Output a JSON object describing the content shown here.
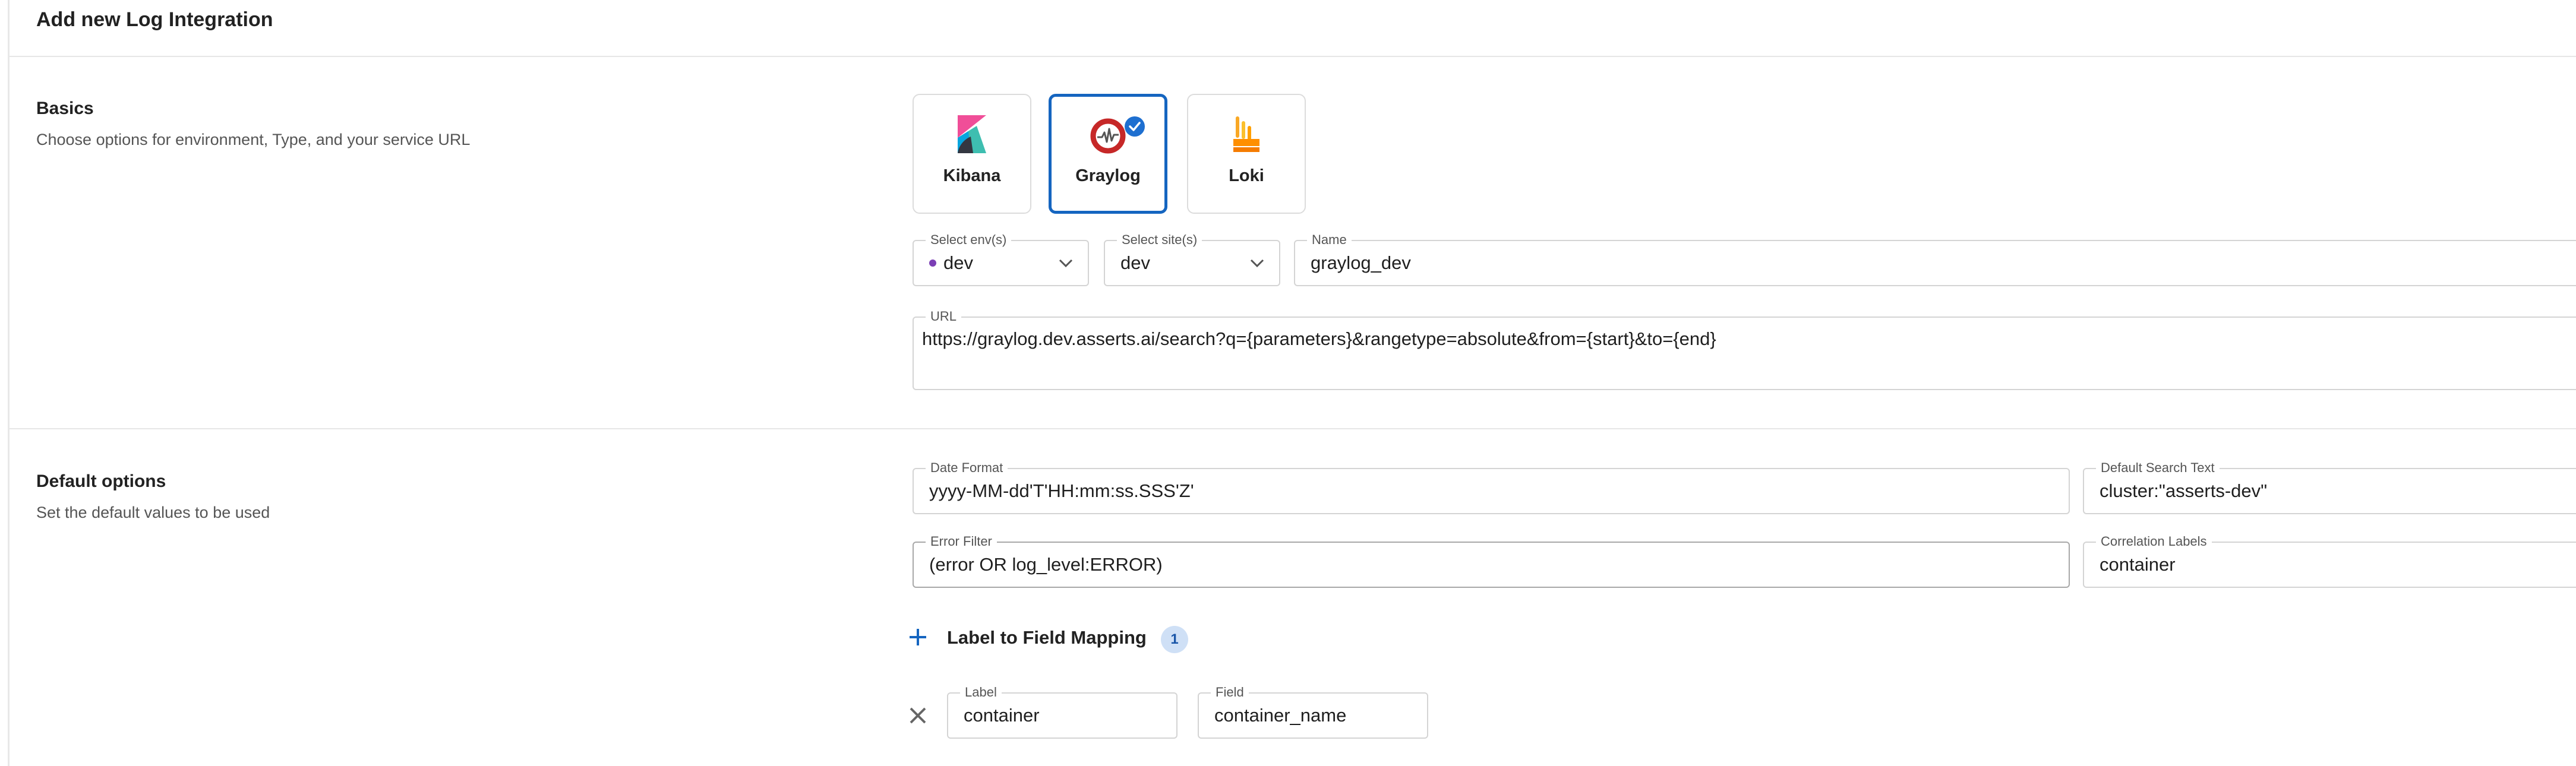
{
  "page": {
    "title": "Add new Log Integration"
  },
  "basics": {
    "title": "Basics",
    "subtitle": "Choose options for environment, Type, and your service URL",
    "types": [
      {
        "label": "Kibana",
        "icon": "kibana-logo-icon",
        "selected": false
      },
      {
        "label": "Graylog",
        "icon": "graylog-logo-icon",
        "selected": true
      },
      {
        "label": "Loki",
        "icon": "loki-logo-icon",
        "selected": false
      }
    ],
    "env": {
      "label": "Select env(s)",
      "value": "dev",
      "dot_color": "#7b3fb5"
    },
    "site": {
      "label": "Select site(s)",
      "value": "dev"
    },
    "name": {
      "label": "Name",
      "value": "graylog_dev"
    },
    "url": {
      "label": "URL",
      "value": "https://graylog.dev.asserts.ai/search?q={parameters}&rangetype=absolute&from={start}&to={end}"
    }
  },
  "defaults": {
    "title": "Default options",
    "subtitle": "Set the default values to be used",
    "date_format": {
      "label": "Date Format",
      "value": "yyyy-MM-dd'T'HH:mm:ss.SSS'Z'"
    },
    "search_text": {
      "label": "Default Search Text",
      "value": "cluster:\"asserts-dev\""
    },
    "error_filter": {
      "label": "Error Filter",
      "value": "(error OR log_level:ERROR)"
    },
    "correlation": {
      "label": "Correlation Labels",
      "value": "container"
    },
    "mapping": {
      "title": "Label to Field Mapping",
      "count": "1",
      "rows": [
        {
          "label_caption": "Label",
          "label_value": "container",
          "field_caption": "Field",
          "field_value": "container_name"
        }
      ]
    }
  },
  "colors": {
    "accent": "#1565c0",
    "check": "#1e6fd0",
    "badge_bg": "#cfe0f6"
  }
}
